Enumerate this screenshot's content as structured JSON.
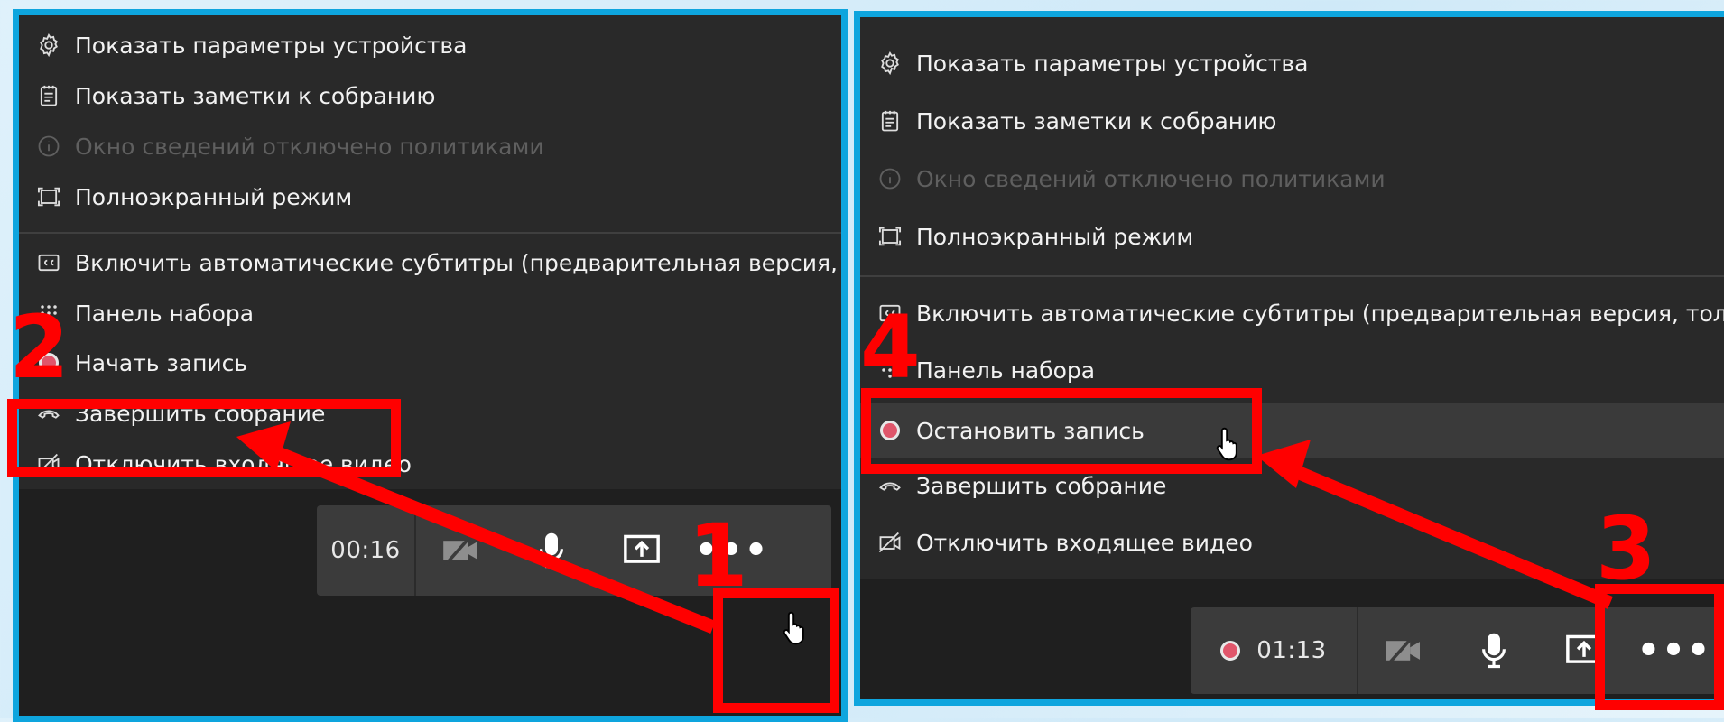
{
  "left_panel": {
    "menu": [
      {
        "icon": "gear-icon",
        "label": "Показать параметры устройства"
      },
      {
        "icon": "notes-icon",
        "label": "Показать заметки к собранию"
      },
      {
        "icon": "info-icon",
        "label": "Окно сведений отключено политиками",
        "disabled": true
      },
      {
        "icon": "fullscreen-icon",
        "label": "Полноэкранный режим"
      },
      {
        "icon": "captions-icon",
        "label": "Включить автоматические субтитры (предварительная версия, то"
      },
      {
        "icon": "dialpad-icon",
        "label": "Панель набора"
      },
      {
        "icon": "record-icon",
        "label": "Начать запись"
      },
      {
        "icon": "hangup-icon",
        "label": "Завершить собрание"
      },
      {
        "icon": "video-off-icon",
        "label": "Отключить входящее видео"
      }
    ],
    "toolbar": {
      "timer": "00:16",
      "more_label": "•••"
    }
  },
  "right_panel": {
    "menu": [
      {
        "icon": "gear-icon",
        "label": "Показать параметры устройства"
      },
      {
        "icon": "notes-icon",
        "label": "Показать заметки к собранию"
      },
      {
        "icon": "info-icon",
        "label": "Окно сведений отключено политиками",
        "disabled": true
      },
      {
        "icon": "fullscreen-icon",
        "label": "Полноэкранный режим"
      },
      {
        "icon": "captions-icon",
        "label": "Включить автоматические субтитры (предварительная версия, только ан"
      },
      {
        "icon": "dialpad-icon",
        "label": "Панель набора"
      },
      {
        "icon": "record-icon",
        "label": "Остановить запись"
      },
      {
        "icon": "hangup-icon",
        "label": "Завершить собрание"
      },
      {
        "icon": "video-off-icon",
        "label": "Отключить входящее видео"
      }
    ],
    "toolbar": {
      "timer": "01:13",
      "more_label": "•••"
    }
  },
  "annotations": [
    "1",
    "2",
    "3",
    "4"
  ],
  "colors": {
    "frame": "#0ea5de",
    "annotation": "#ff0000",
    "menu_bg": "#292929",
    "record_dot": "#e0566b"
  }
}
